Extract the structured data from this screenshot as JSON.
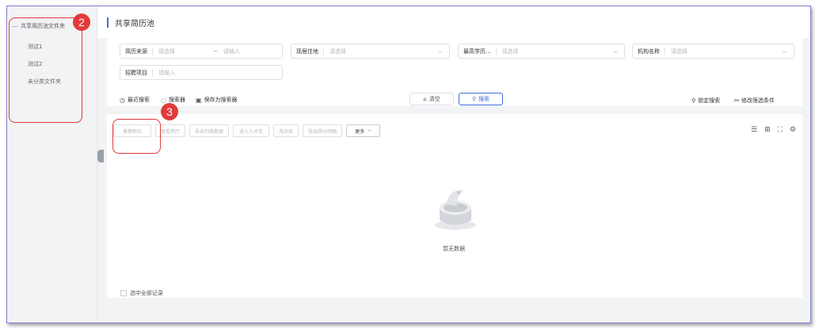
{
  "sidebar": {
    "root_label": "共享简历池文件夹",
    "root_icon": "minus-icon",
    "items": [
      {
        "label": "测试1"
      },
      {
        "label": "测试2"
      },
      {
        "label": "未分类文件夹"
      }
    ]
  },
  "annotations": {
    "badge_2": "2",
    "badge_3": "3",
    "color": "#e23b3b"
  },
  "page": {
    "title": "共享简历池",
    "accent_color": "#3d6fd9"
  },
  "filters": {
    "source": {
      "label": "简历来源",
      "placeholder": "请选择",
      "tilde": "~",
      "input_placeholder": "请输入"
    },
    "residence": {
      "label": "现居住地",
      "placeholder": "请选择"
    },
    "education": {
      "label": "最高学历...",
      "placeholder": "请选择"
    },
    "org": {
      "label": "机构名称",
      "placeholder": "请选择"
    },
    "project": {
      "label": "招聘项目",
      "placeholder": "请输入"
    }
  },
  "options": {
    "recent": "最近搜索",
    "searcher": "搜索器",
    "save_searcher": "保存为搜索器",
    "clear": "清空",
    "search": "搜索",
    "lock_search": "锁定搜索",
    "modify_conditions": "修改筛选条件"
  },
  "toolbar": {
    "recommend": "推荐职位",
    "view_resume": "查看简历",
    "export_list": "导出列表数据",
    "add_talent": "进入人才库",
    "eliminate": "淘汰库",
    "export_scores": "导出得分明细",
    "more": "更多"
  },
  "list": {
    "empty_text": "暂无数据",
    "select_all": "选中全部记录"
  }
}
